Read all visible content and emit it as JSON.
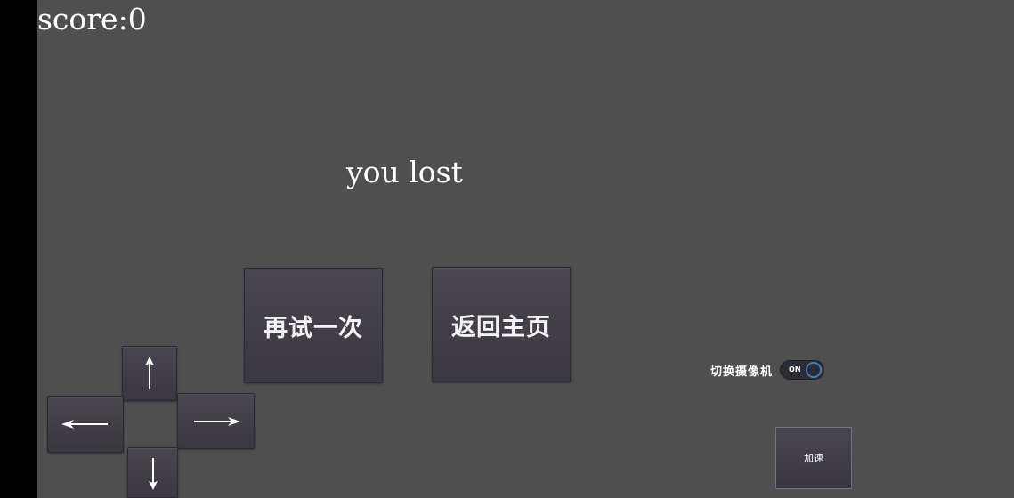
{
  "hud": {
    "score_text": "score:0",
    "status_text": "you lost"
  },
  "menu": {
    "retry_label": "再试一次",
    "home_label": "返回主页"
  },
  "dpad": {
    "up": "up-arrow-icon",
    "down": "down-arrow-icon",
    "left": "left-arrow-icon",
    "right": "right-arrow-icon"
  },
  "camera_toggle": {
    "label": "切换摄像机",
    "state_text": "ON",
    "on": true
  },
  "boost": {
    "label": "加速"
  },
  "colors": {
    "background": "#4f4f4f",
    "button_fill": "#403d46",
    "toggle_accent": "#4a7ab8"
  }
}
